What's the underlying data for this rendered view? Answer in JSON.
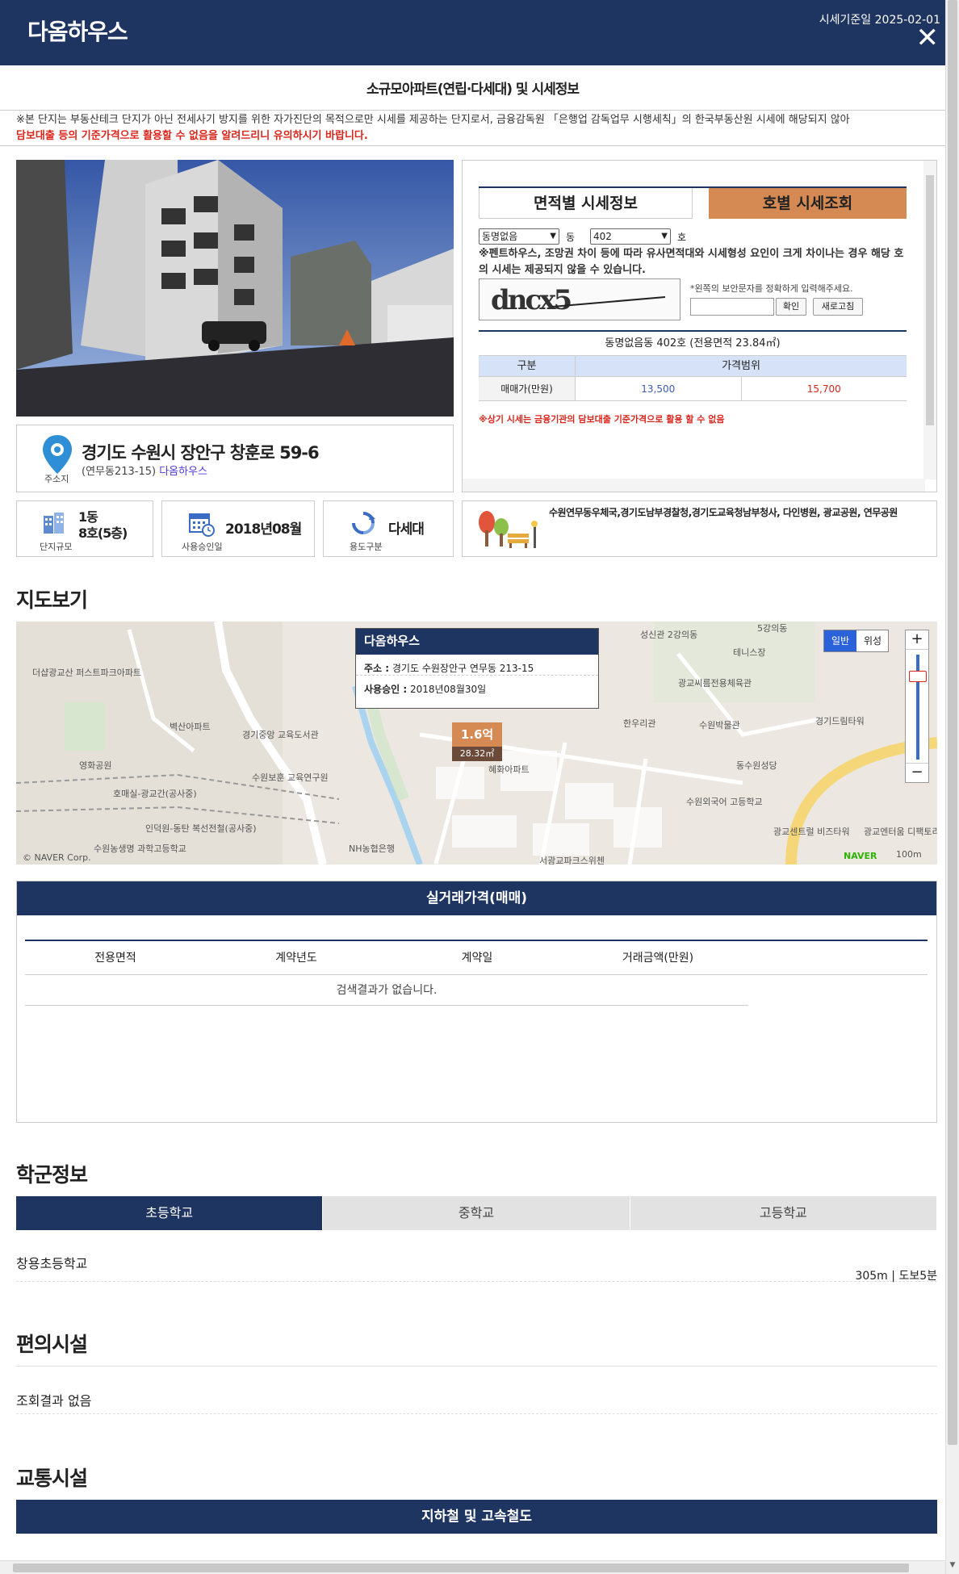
{
  "header": {
    "title": "다옴하우스",
    "date": "시세기준일 2025-02-01",
    "close": "✕"
  },
  "subtitle": "소규모아파트(연립·다세대) 및 시세정보",
  "notice": {
    "line1": "※본 단지는 부동산테크 단지가 아닌 전세사기 방지를 위한 자가진단의 목적으로만 시세를 제공하는 단지로서, 금융감독원 「은행업 감독업무 시행세칙」의 한국부동산원 시세에 해당되지 않아",
    "line2": "담보대출 등의 기준가격으로 활용할 수 없음을 알려드리니 유의하시기 바랍니다."
  },
  "address": {
    "pin_label": "주소지",
    "main": "경기도 수원시 장안구 창훈로 59-6",
    "sub": "(연무동213-15)",
    "link": "다옴하우스"
  },
  "price": {
    "tab1": "면적별 시세정보",
    "tab2": "호별 시세조회",
    "dong_select": "동명없음",
    "dong_unit": "동",
    "ho_select": "402",
    "ho_unit": "호",
    "warning": "※펜트하우스, 조망권 차이 등에 따라 유사면적대와 시세형성 요인이 크게 차이나는 경우 해당 호의 시세는 제공되지 않을 수 있습니다.",
    "captcha_text": "dncx5",
    "captcha_note": "*왼쪽의 보안문자를 정확하게 입력해주세요.",
    "confirm": "확인",
    "refresh": "새로고침",
    "result_title": "동명없음동 402호 (전용면적 23.84㎡)",
    "col_kind": "구분",
    "col_range": "가격범위",
    "row_label": "매매가(만원)",
    "low": "13,500",
    "high": "15,700",
    "note": "※상기 시세는 금융기관의 담보대출 기준가격으로 활용 할 수 없음"
  },
  "info": {
    "scale_value": "1동\n8호(5층)",
    "scale_label": "단지규모",
    "approval_value": "2018년08월",
    "approval_label": "사용승인일",
    "use_value": "다세대",
    "use_label": "용도구분",
    "facilities": "수원연무동우체국,경기도남부경찰청,경기도교육청남부청사, 다인병원, 광교공원, 연무공원"
  },
  "map_section": {
    "title": "지도보기",
    "popup_title": "다옴하우스",
    "popup_addr_label": "주소 :",
    "popup_addr": "경기도 수원장안구 연무동 213-15",
    "popup_date_label": "사용승인 :",
    "popup_date": "2018년08월30일",
    "marker_price": "1.6억",
    "marker_area": "28.32㎡",
    "type_normal": "일반",
    "type_sat": "위성",
    "zoom_in": "+",
    "zoom_out": "−",
    "labels": [
      "더샵광교산 퍼스트파크아파트",
      "벽산아파트",
      "경기중앙 교육도서관",
      "영화공원",
      "수원보훈 교육연구원",
      "수원농생명 과학고등학교",
      "NH농협은행",
      "성신관 2강의동",
      "5강의동",
      "테니스장",
      "광교씨름전용체육관",
      "한우리관",
      "수원박물관",
      "경기드림타워",
      "동수원성당",
      "수원외국어 고등학교",
      "광교센트럴 비즈타워",
      "광교엔터움 디팩토리",
      "서광교파크스위첸",
      "혜화아파트",
      "호매실-광교간(공사중)",
      "인덕원-동탄 복선전철(공사중)",
      "© NAVER Corp.",
      "NAVER",
      "100m"
    ]
  },
  "trade": {
    "bar": "실거래가격(매매)",
    "cols": [
      "전용면적",
      "계약년도",
      "계약일",
      "거래금액(만원)"
    ],
    "empty": "검색결과가 없습니다."
  },
  "school": {
    "title": "학군정보",
    "tabs": [
      "초등학교",
      "중학교",
      "고등학교"
    ],
    "name": "창용초등학교",
    "dist": "305m",
    "walk": "도보5분"
  },
  "conv": {
    "title": "편의시설",
    "empty": "조회결과 없음"
  },
  "transport": {
    "title": "교통시설",
    "bar": "지하철 및 고속철도"
  }
}
